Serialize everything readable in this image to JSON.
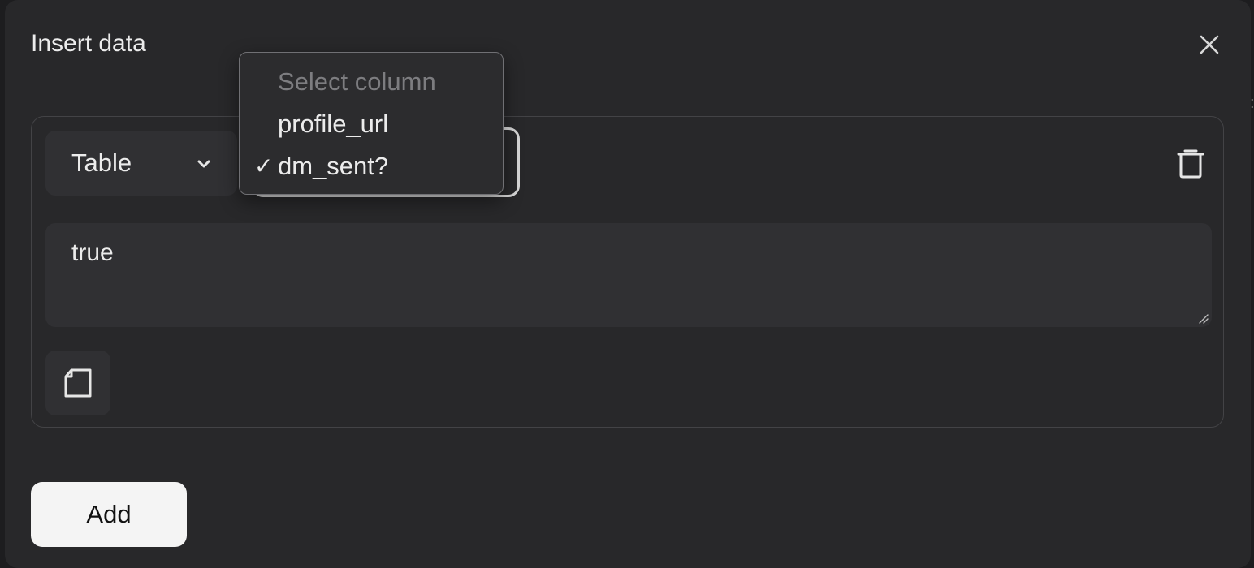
{
  "dialog": {
    "title": "Insert data"
  },
  "row": {
    "table_select": {
      "label": "Table"
    },
    "column_dropdown": {
      "placeholder": "Select column",
      "options": [
        "profile_url",
        "dm_sent?"
      ],
      "selected": "dm_sent?",
      "check_mark": "✓"
    },
    "value": "true"
  },
  "actions": {
    "add_label": "Add"
  },
  "icons": {
    "close": "close-icon",
    "chevron": "chevron-down-icon",
    "trash": "trash-icon",
    "document": "document-icon",
    "resize": "resize-grip-icon"
  },
  "colors": {
    "background": "#28282a",
    "field": "#303033",
    "border": "#434346",
    "text": "#ececec",
    "primary_button": "#f4f4f4"
  }
}
